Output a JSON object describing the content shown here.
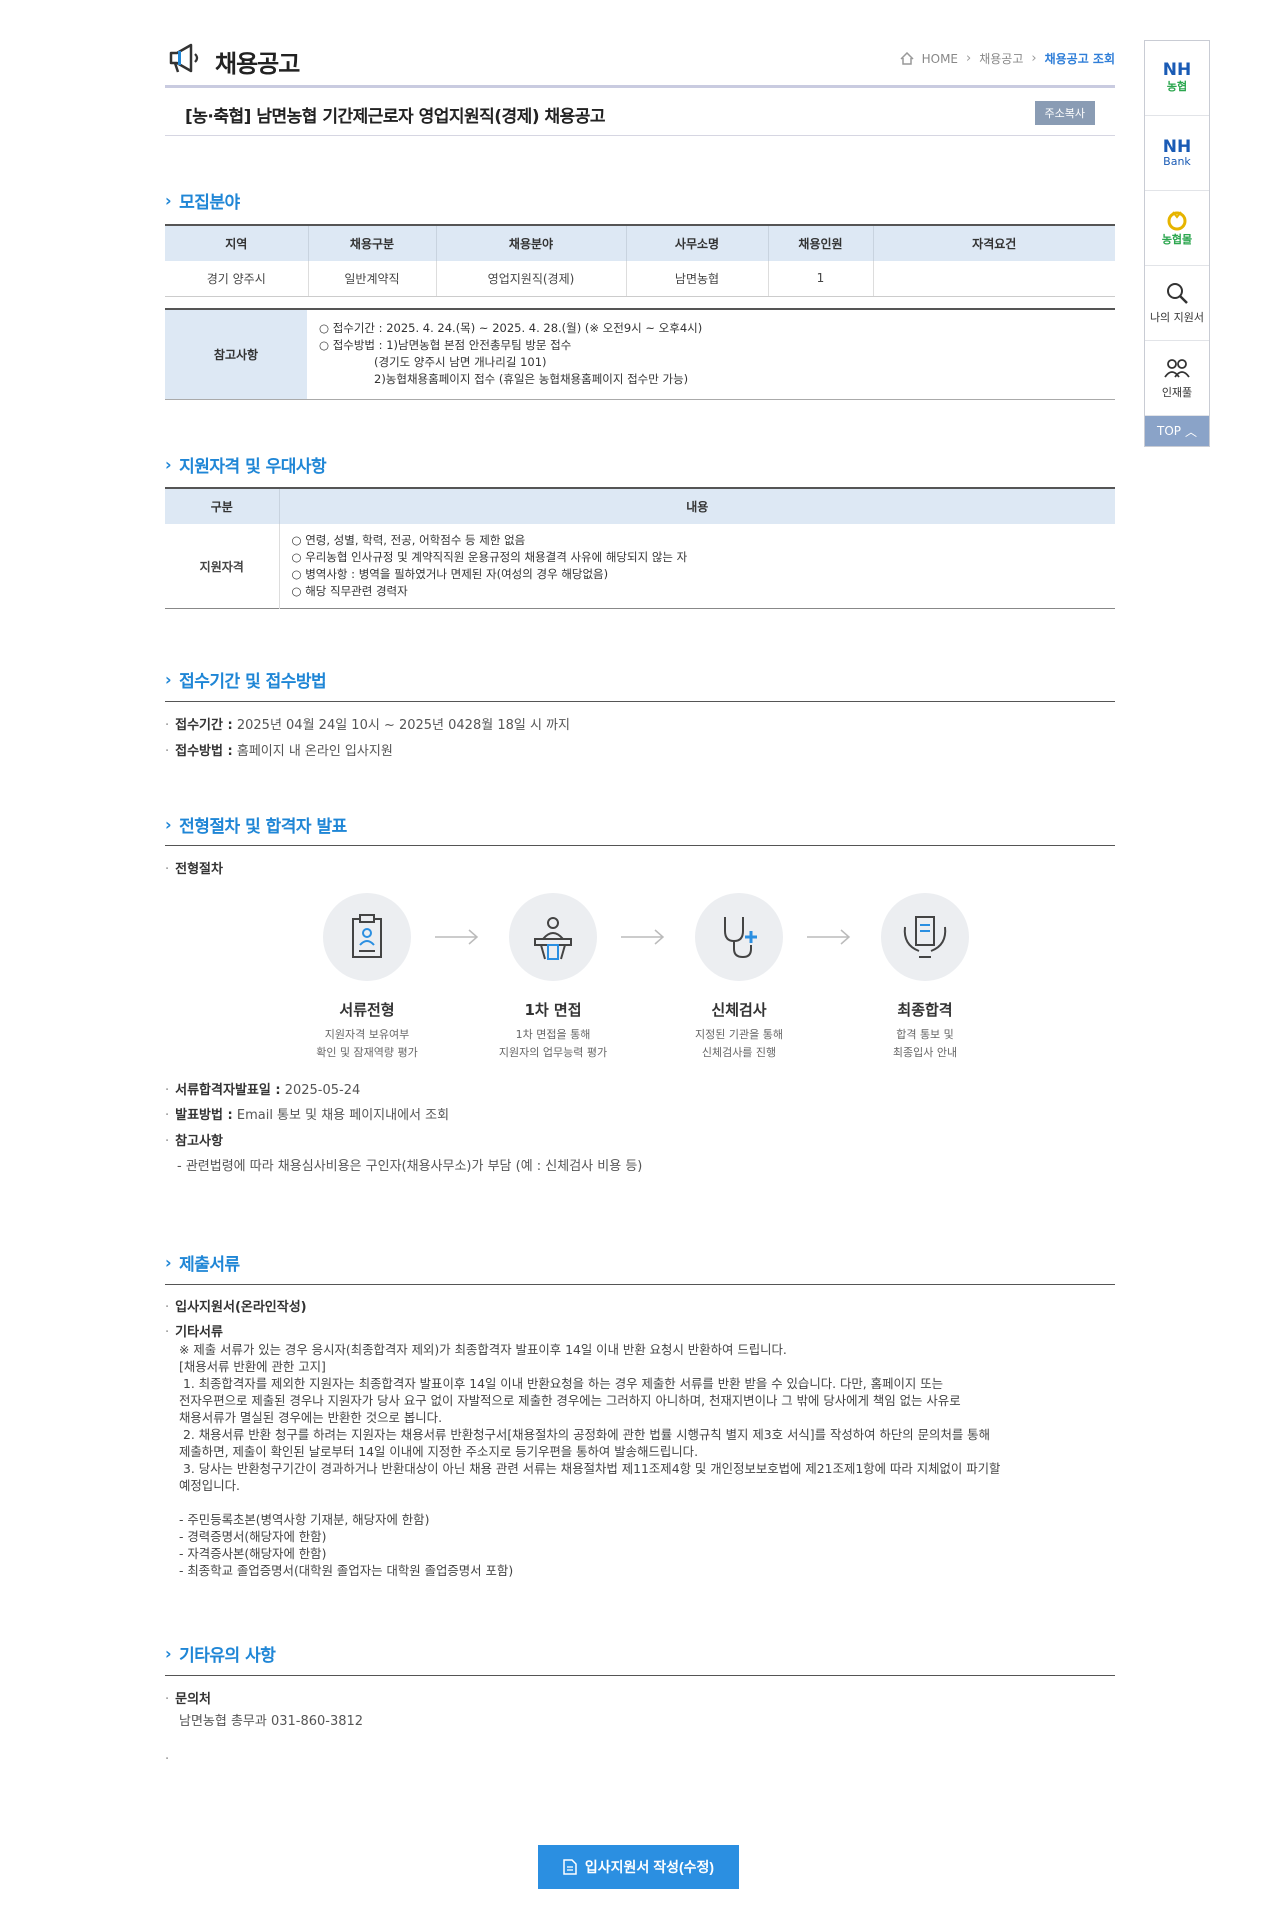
{
  "header": {
    "title": "채용공고",
    "breadcrumb": [
      "HOME",
      "채용공고",
      "채용공고 조회"
    ]
  },
  "post": {
    "title": "[농·축협] 남면농협 기간제근로자 영업지원직(경제) 채용공고",
    "copy_label": "주소복사"
  },
  "recruit": {
    "title": "모집분야",
    "columns": [
      "지역",
      "채용구분",
      "채용분야",
      "사무소명",
      "채용인원",
      "자격요건"
    ],
    "rows": [
      [
        "경기 양주시",
        "일반계약직",
        "영업지원직(경제)",
        "남면농협",
        "1",
        ""
      ]
    ],
    "note_label": "참고사항",
    "notes": [
      "○ 접수기간 : 2025. 4. 24.(목) ~ 2025. 4. 28.(월) (※ 오전9시 ~ 오후4시)",
      "○ 접수방법 : 1)남면농협 본점 안전총무팀 방문 접수",
      "(경기도 양주시 남면 개나리길 101)",
      "2)농협채용홈페이지 접수 (휴일은 농협채용홈페이지 접수만 가능)"
    ]
  },
  "qualification": {
    "title": "지원자격 및 우대사항",
    "col_type": "구분",
    "col_content": "내용",
    "row_label": "지원자격",
    "items": [
      "○ 연령, 성별, 학력, 전공, 어학점수 등 제한 없음",
      "○ 우리농협 인사규정 및 계약직직원 운용규정의 채용결격 사유에 해당되지 않는 자",
      "○ 병역사항 : 병역을 필하였거나 면제된 자(여성의 경우 해당없음)",
      "○ 해당 직무관련 경력자"
    ]
  },
  "application": {
    "title": "접수기간 및 접수방법",
    "period_label": "접수기간 :",
    "period_value": "2025년 04월 24일 10시 ~ 2025년 0428월 18일 시 까지",
    "method_label": "접수방법 :",
    "method_value": "홈페이지 내 온라인 입사지원"
  },
  "process": {
    "title": "전형절차 및 합격자 발표",
    "sub_label": "전형절차",
    "steps": [
      {
        "name": "서류전형",
        "desc1": "지원자격 보유여부",
        "desc2": "확인 및 잠재역량 평가",
        "icon": "document-icon"
      },
      {
        "name": "1차 면접",
        "desc1": "1차 면접을 통해",
        "desc2": "지원자의 업무능력 평가",
        "icon": "interview-icon"
      },
      {
        "name": "신체검사",
        "desc1": "지정된 기관을 통해",
        "desc2": "신체검사를 진행",
        "icon": "stethoscope-icon"
      },
      {
        "name": "최종합격",
        "desc1": "합격 통보 및",
        "desc2": "최종입사 안내",
        "icon": "certificate-icon"
      }
    ],
    "announce_label": "서류합격자발표일 :",
    "announce_value": "2025-05-24",
    "notify_label": "발표방법 :",
    "notify_value": "Email 통보 및 채용 페이지내에서 조회",
    "note_label": "참고사항",
    "note_value": "- 관련법령에 따라 채용심사비용은 구인자(채용사무소)가 부담 (예 : 신체검사 비용 등)"
  },
  "documents": {
    "title": "제출서류",
    "item1": "입사지원서(온라인작성)",
    "item2": "기타서류",
    "body": "※ 제출 서류가 있는 경우 응시자(최종합격자 제외)가 최종합격자 발표이후 14일 이내 반환 요청시 반환하여 드립니다.\n[채용서류 반환에 관한 고지]\n 1. 최종합격자를 제외한 지원자는 최종합격자 발표이후 14일 이내 반환요청을 하는 경우 제출한 서류를 반환 받을 수 있습니다. 다만, 홈페이지 또는\n전자우편으로 제출된 경우나 지원자가 당사 요구 없이 자발적으로 제출한 경우에는 그러하지 아니하며, 천재지변이나 그 밖에 당사에게 책임 없는 사유로\n채용서류가 멸실된 경우에는 반환한 것으로 봅니다.\n 2. 채용서류 반환 청구를 하려는 지원자는 채용서류 반환청구서[채용절차의 공정화에 관한 법률 시행규칙 별지 제3호 서식]를 작성하여 하단의 문의처를 통해\n제출하면, 제출이 확인된 날로부터 14일 이내에 지정한 주소지로 등기우편을 통하여 발송해드립니다.\n 3. 당사는 반환청구기간이 경과하거나 반환대상이 아닌 채용 관련 서류는 채용절차법 제11조제4항 및 개인정보보호법에 제21조제1항에 따라 지체없이 파기할\n예정입니다.\n\n- 주민등록초본(병역사항 기재분, 해당자에 한함)\n- 경력증명서(해당자에 한함)\n- 자격증사본(해당자에 한함)\n- 최종학교 졸업증명서(대학원 졸업자는 대학원 졸업증명서 포함)"
  },
  "etc": {
    "title": "기타유의 사항",
    "contact_label": "문의처",
    "contact_value": "남면농협 총무과 031-860-3812"
  },
  "quick_menu": {
    "nh_logo": "NH",
    "nh_logo_sub": "농협",
    "bank_logo": "NH",
    "bank_logo_sub": "Bank",
    "nonghyup_sub": "농협몰",
    "my_apply": "나의 지원서",
    "talent": "인재풀",
    "top": "TOP"
  },
  "apply_button": "입사지원서 작성(수정)",
  "colors": {
    "accent": "#1f86d6",
    "header_bg": "#dde8f4",
    "button": "#2b8fe1"
  }
}
